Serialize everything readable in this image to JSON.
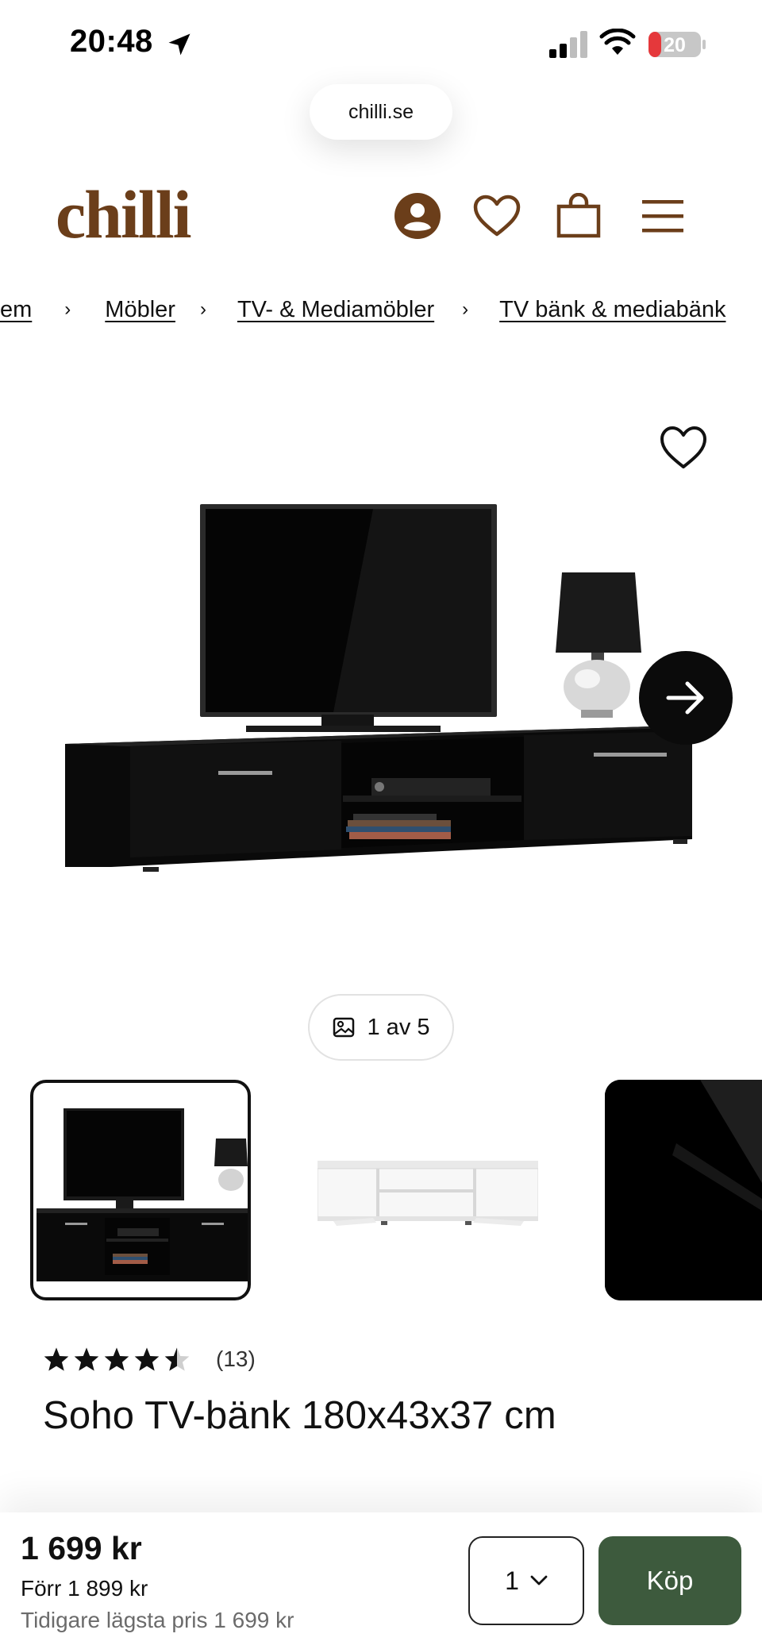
{
  "status_bar": {
    "time": "20:48",
    "battery": "20"
  },
  "browser": {
    "url": "chilli.se"
  },
  "header": {
    "logo": "chilli"
  },
  "breadcrumb": {
    "items": [
      "em",
      "Möbler",
      "TV- & Mediamöbler",
      "TV bänk & mediabänk"
    ],
    "separator": "›"
  },
  "gallery": {
    "counter": "1 av 5"
  },
  "product": {
    "rating": 4.5,
    "review_count": "(13)",
    "title": "Soho TV-bänk 180x43x37 cm",
    "price": "1 699 kr",
    "old_price": "Förr 1 899 kr",
    "lowest_price": "Tidigare lägsta pris 1 699 kr"
  },
  "buy_bar": {
    "quantity": "1",
    "buy_label": "Köp"
  },
  "colors": {
    "brand": "#6b3e1a",
    "buy_button": "#3d5a3d",
    "text": "#111111"
  },
  "icons": [
    "location-arrow-icon",
    "signal-icon",
    "wifi-icon",
    "battery-icon",
    "account-icon",
    "heart-icon",
    "cart-icon",
    "menu-icon",
    "arrow-right-icon",
    "image-icon",
    "star-icon",
    "chevron-down-icon"
  ]
}
